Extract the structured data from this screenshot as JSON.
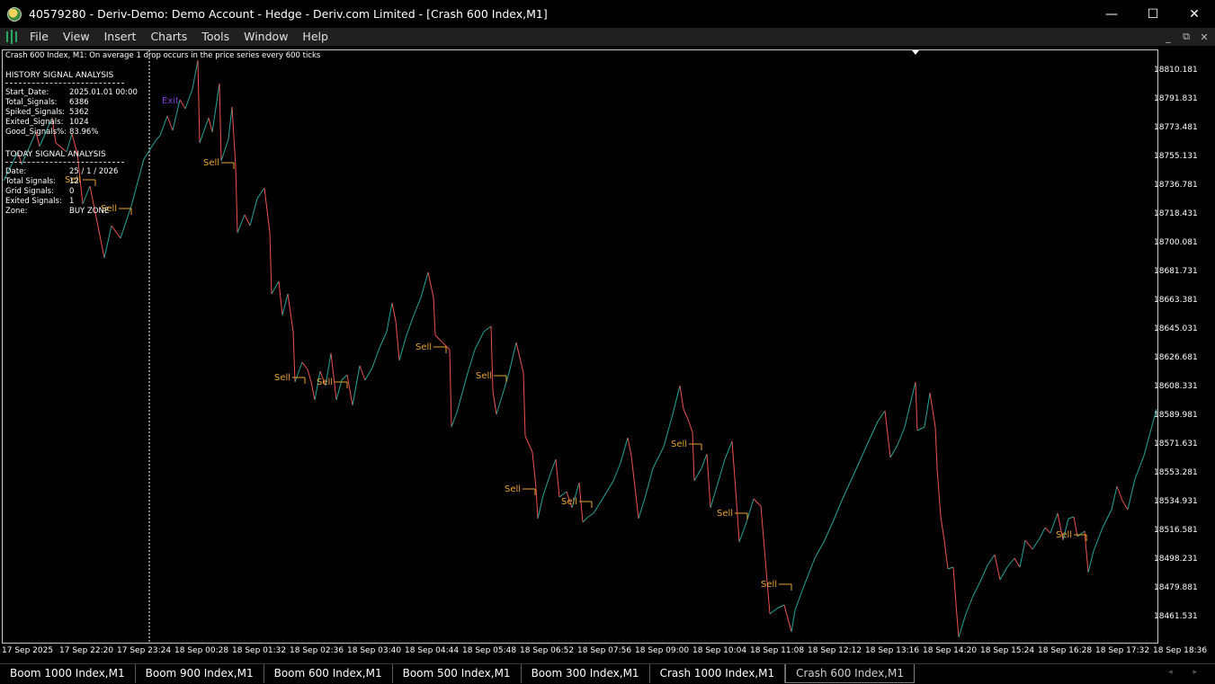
{
  "window": {
    "title": "40579280 - Deriv-Demo: Demo Account - Hedge - Deriv.com Limited - [Crash 600 Index,M1]",
    "controls": [
      "—",
      "☐",
      "✕"
    ]
  },
  "menu": {
    "items": [
      "File",
      "View",
      "Insert",
      "Charts",
      "Tools",
      "Window",
      "Help"
    ],
    "mdi": [
      "_",
      "⧉",
      "✕"
    ]
  },
  "chart": {
    "header": "Crash 600 Index, M1:  On average 1 drop occurs in the price series every 600 ticks",
    "history": {
      "title": "HISTORY SIGNAL ANALYSIS",
      "rows": [
        {
          "k": "Start_Date:",
          "v": "2025.01.01 00:00"
        },
        {
          "k": "Total_Signals:",
          "v": "6386"
        },
        {
          "k": "Spiked_Signals:",
          "v": "5362"
        },
        {
          "k": "Exited_Signals:",
          "v": "1024"
        },
        {
          "k": "Good_Signals%:",
          "v": "83.96%"
        }
      ]
    },
    "today": {
      "title": "TODAY SIGNAL ANALYSIS",
      "rows": [
        {
          "k": "Date:",
          "v": "25 / 1 / 2026"
        },
        {
          "k": "Total Signals:",
          "v": "12"
        },
        {
          "k": "Grid Signals:",
          "v": "0"
        },
        {
          "k": "Exited Signals:",
          "v": "1"
        },
        {
          "k": "Zone:",
          "v": "BUY ZONE"
        }
      ]
    },
    "price_axis": [
      "18810.181",
      "18791.831",
      "18773.481",
      "18755.131",
      "18736.781",
      "18718.431",
      "18700.081",
      "18681.731",
      "18663.381",
      "18645.031",
      "18626.681",
      "18608.331",
      "18589.981",
      "18571.631",
      "18553.281",
      "18534.931",
      "18516.581",
      "18498.231",
      "18479.881",
      "18461.531"
    ],
    "time_axis": [
      "17 Sep 2025",
      "17 Sep 22:20",
      "17 Sep 23:24",
      "18 Sep 00:28",
      "18 Sep 01:32",
      "18 Sep 02:36",
      "18 Sep 03:40",
      "18 Sep 04:44",
      "18 Sep 05:48",
      "18 Sep 06:52",
      "18 Sep 07:56",
      "18 Sep 09:00",
      "18 Sep 10:04",
      "18 Sep 11:08",
      "18 Sep 12:12",
      "18 Sep 13:16",
      "18 Sep 14:20",
      "18 Sep 15:24",
      "18 Sep 16:28",
      "18 Sep 17:32",
      "18 Sep 18:36"
    ],
    "signal_labels": [
      "Sell",
      "Sell",
      "Sell",
      "Sell",
      "Sell",
      "Sell",
      "Sell",
      "Sell",
      "Sell",
      "Sell",
      "Sell",
      "Sell",
      "Sell"
    ],
    "exit_label": "Exit",
    "colors": {
      "up": "#26a69a",
      "down": "#ef5350",
      "signal": "#e8a530",
      "exit": "#7b3fd4",
      "background": "#000000"
    }
  },
  "tabs": {
    "items": [
      "Boom 1000 Index,M1",
      "Boom 900 Index,M1",
      "Boom 600 Index,M1",
      "Boom 500 Index,M1",
      "Boom 300 Index,M1",
      "Crash 1000 Index,M1",
      "Crash 600 Index,M1"
    ],
    "active": 6,
    "arrows": "◂ ▸"
  }
}
